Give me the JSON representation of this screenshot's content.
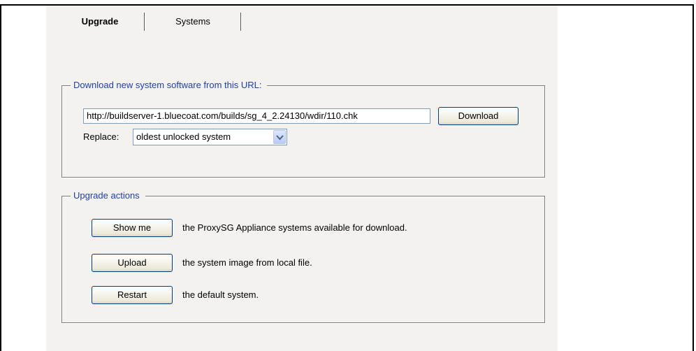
{
  "tabs": [
    {
      "label": "Upgrade",
      "active": true
    },
    {
      "label": "Systems",
      "active": false
    }
  ],
  "download_section": {
    "title": "Download new system software from this URL:",
    "url_value": "http://buildserver-1.bluecoat.com/builds/sg_4_2.24130/wdir/110.chk",
    "download_label": "Download",
    "replace_label": "Replace:",
    "replace_selected": "oldest unlocked system"
  },
  "actions_section": {
    "title": "Upgrade actions",
    "actions": [
      {
        "button": "Show me",
        "text": "the ProxySG Appliance systems available for download."
      },
      {
        "button": "Upload",
        "text": "the system image from local file."
      },
      {
        "button": "Restart",
        "text": "the default system."
      }
    ]
  },
  "colors": {
    "panel_background": "#f3f2ee",
    "legend_text": "#1f3fa8",
    "input_border": "#7f9db9",
    "button_border": "#003c74"
  },
  "icons": {
    "dropdown": "chevron-down-icon"
  }
}
